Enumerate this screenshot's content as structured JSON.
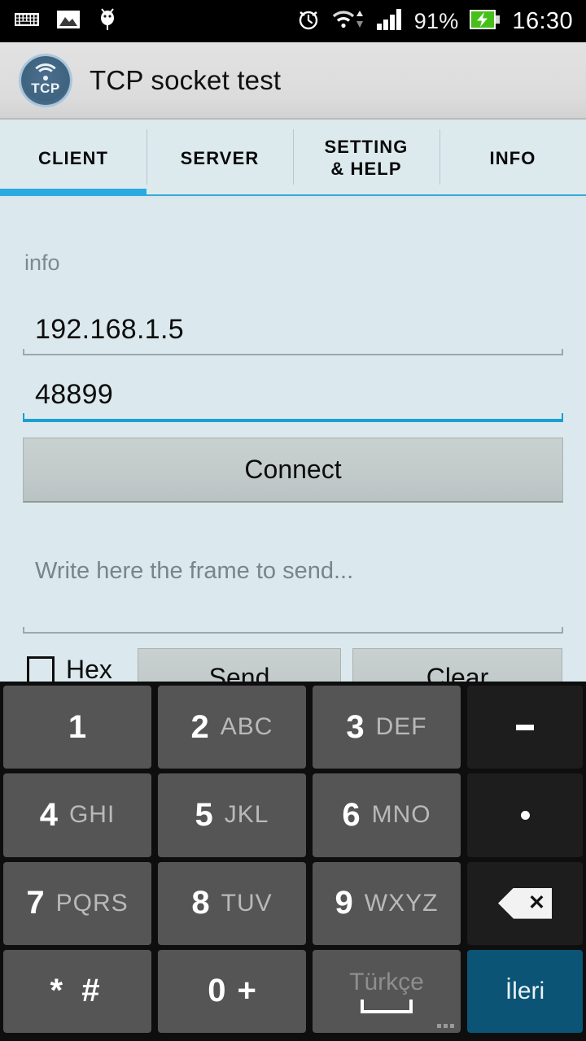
{
  "statusbar": {
    "left_icons": [
      "keyboard-icon",
      "image-icon",
      "bug-icon"
    ],
    "alarm_icon": "alarm-icon",
    "wifi_icon": "wifi-icon",
    "signal_icon": "signal-bars-icon",
    "battery_percent": "91%",
    "battery_icon": "battery-charging-icon",
    "clock": "16:30"
  },
  "actionbar": {
    "app_icon": "tcp-app-icon",
    "icon_text": "TCP",
    "title": "TCP socket test"
  },
  "tabs": [
    {
      "label": "CLIENT",
      "active": true
    },
    {
      "label": "SERVER",
      "active": false
    },
    {
      "label": "SETTING\n& HELP",
      "line1": "SETTING",
      "line2": "& HELP",
      "active": false
    },
    {
      "label": "INFO",
      "active": false
    }
  ],
  "client": {
    "section_label": "info",
    "ip": {
      "value": "192.168.1.5",
      "focused": false
    },
    "port": {
      "value": "48899",
      "focused": true
    },
    "connect_label": "Connect",
    "frame_input": {
      "value": "",
      "placeholder": "Write here the frame to send..."
    },
    "hex_label": "Hex",
    "hex_checked": false,
    "send_label": "Send",
    "clear_label": "Clear"
  },
  "keyboard": {
    "rows": [
      [
        {
          "digit": "1",
          "letters": ""
        },
        {
          "digit": "2",
          "letters": "ABC"
        },
        {
          "digit": "3",
          "letters": "DEF"
        },
        {
          "type": "dash",
          "label": "-"
        }
      ],
      [
        {
          "digit": "4",
          "letters": "GHI"
        },
        {
          "digit": "5",
          "letters": "JKL"
        },
        {
          "digit": "6",
          "letters": "MNO"
        },
        {
          "type": "period",
          "label": "."
        }
      ],
      [
        {
          "digit": "7",
          "letters": "PQRS"
        },
        {
          "digit": "8",
          "letters": "TUV"
        },
        {
          "digit": "9",
          "letters": "WXYZ"
        },
        {
          "type": "backspace",
          "label": "backspace"
        }
      ],
      [
        {
          "type": "symbols",
          "label": "* #"
        },
        {
          "digit": "0",
          "letters": "+"
        },
        {
          "type": "space",
          "label": "Türkçe"
        },
        {
          "type": "enter",
          "label": "İleri"
        }
      ]
    ]
  },
  "colors": {
    "accent_blue": "#29aae1",
    "focused_underline": "#1b9fd0",
    "body_background": "#dbe9ee",
    "key_background": "#555555",
    "key_dark": "#1d1d1d",
    "enter_key": "#0b5475",
    "battery_green": "#46c018"
  }
}
